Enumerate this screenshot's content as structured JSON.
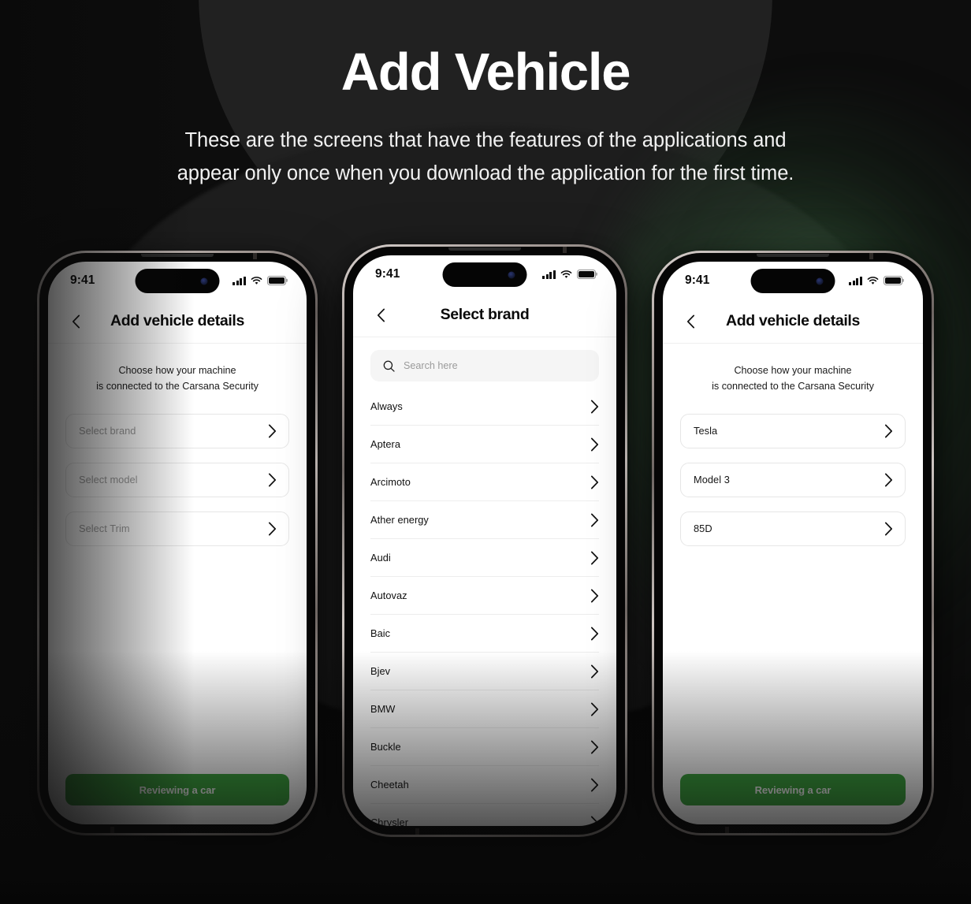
{
  "page": {
    "title": "Add Vehicle",
    "subtitle_line1": "These are the screens that have the features of the applications and",
    "subtitle_line2": "appear only  once when you download the application for the first time.",
    "background_color": "#0d0d0d",
    "accent_color": "#3aa43c"
  },
  "status_bar": {
    "time": "9:41",
    "cellular_icon": "cellular-bars-icon",
    "wifi_icon": "wifi-icon",
    "battery_icon": "battery-full-icon"
  },
  "screens": [
    {
      "id": "add-vehicle-details-empty",
      "nav": {
        "back_icon": "chevron-left-icon",
        "title": "Add vehicle details"
      },
      "subtitle_line1": "Choose how your machine",
      "subtitle_line2": "is connected to the Carsana Security",
      "fields": [
        {
          "name": "brand",
          "value": "Select brand",
          "filled": false,
          "chevron": "chevron-right-icon"
        },
        {
          "name": "model",
          "value": "Select model",
          "filled": false,
          "chevron": "chevron-right-icon"
        },
        {
          "name": "trim",
          "value": "Select Trim",
          "filled": false,
          "chevron": "chevron-right-icon"
        }
      ],
      "cta_label": "Reviewing a car"
    },
    {
      "id": "select-brand",
      "nav": {
        "back_icon": "chevron-left-icon",
        "title": "Select brand"
      },
      "search": {
        "placeholder": "Search here",
        "icon": "search-icon"
      },
      "brands": [
        "Always",
        "Aptera",
        "Arcimoto",
        "Ather energy",
        "Audi",
        "Autovaz",
        "Baic",
        "Bjev",
        "BMW",
        "Buckle",
        "Cheetah",
        "Chrysler"
      ]
    },
    {
      "id": "add-vehicle-details-filled",
      "nav": {
        "back_icon": "chevron-left-icon",
        "title": "Add vehicle details"
      },
      "subtitle_line1": "Choose how your machine",
      "subtitle_line2": "is connected to the Carsana Security",
      "fields": [
        {
          "name": "brand",
          "value": "Tesla",
          "filled": true,
          "chevron": "chevron-right-icon"
        },
        {
          "name": "model",
          "value": "Model 3",
          "filled": true,
          "chevron": "chevron-right-icon"
        },
        {
          "name": "trim",
          "value": "85D",
          "filled": true,
          "chevron": "chevron-right-icon"
        }
      ],
      "cta_label": "Reviewing a car"
    }
  ]
}
